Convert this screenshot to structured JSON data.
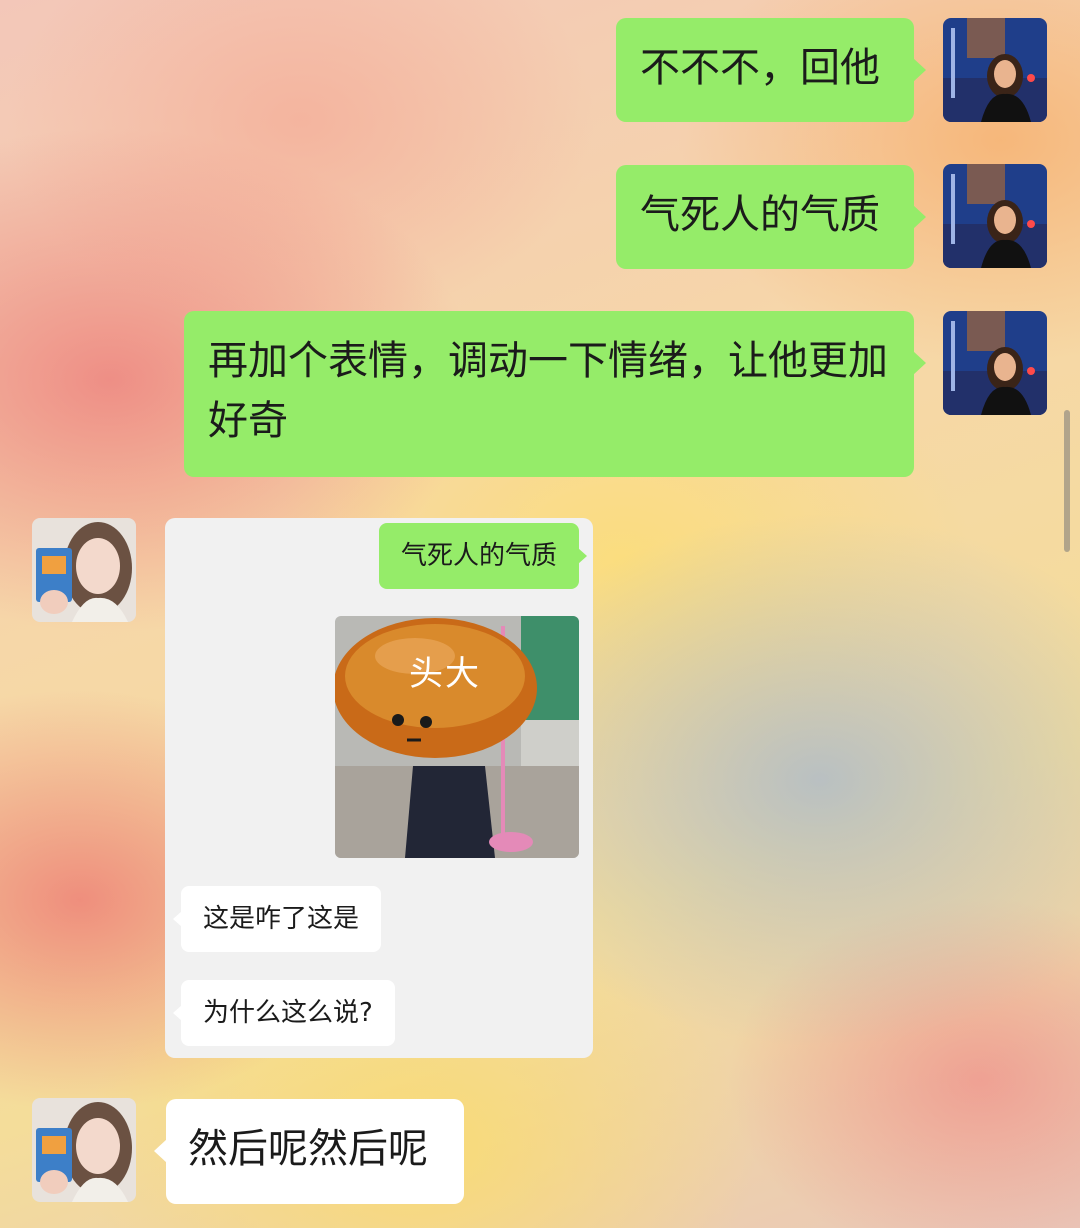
{
  "chat": {
    "messages": [
      {
        "side": "right",
        "text": "不不不，回他"
      },
      {
        "side": "right",
        "text": "气死人的气质"
      },
      {
        "side": "right",
        "text": "再加个表情，调动一下情绪，让他更加好奇"
      },
      {
        "side": "left",
        "type": "forwarded-card"
      },
      {
        "side": "left",
        "text": "然后呢然后呢"
      }
    ]
  },
  "forwarded": {
    "sent_text": "气死人的气质",
    "sticker_caption": "头大",
    "sticker_icon": "bread-head-sticker",
    "reply_1": "这是咋了这是",
    "reply_2": "为什么这么说?"
  },
  "colors": {
    "sent_bubble": "#95ec69",
    "received_bubble": "#ffffff",
    "card_background": "#f1f1f1"
  }
}
